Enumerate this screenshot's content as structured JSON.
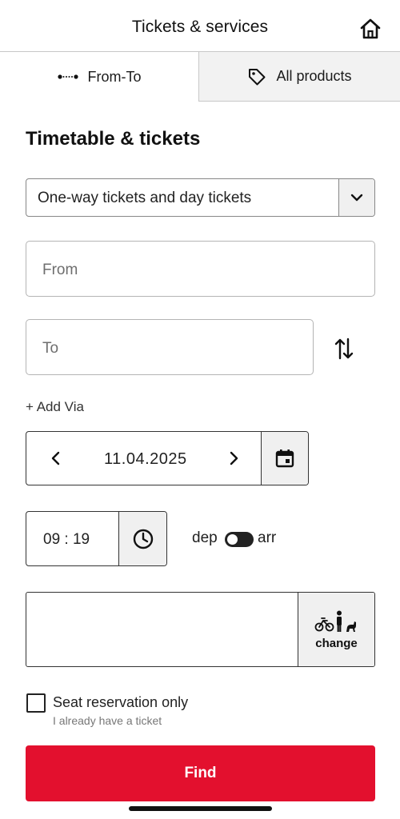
{
  "header": {
    "title": "Tickets & services",
    "home_icon": "home-icon"
  },
  "tabs": [
    {
      "label": "From-To",
      "icon": "route-dots-icon",
      "active": true
    },
    {
      "label": "All products",
      "icon": "tag-icon",
      "active": false
    }
  ],
  "form": {
    "section_title": "Timetable & tickets",
    "ticket_type": {
      "selected": "One-way tickets and day tickets"
    },
    "from": {
      "placeholder": "From",
      "value": ""
    },
    "to": {
      "placeholder": "To",
      "value": ""
    },
    "add_via": "+ Add Via",
    "date": {
      "value": "11.04.2025"
    },
    "time": {
      "value": "09 : 19"
    },
    "dep_arr": {
      "dep_label": "dep",
      "arr_label": "arr",
      "selected": "dep"
    },
    "travellers": {
      "change_label": "change"
    },
    "seat_reservation": {
      "label": "Seat reservation only",
      "hint": "I already have a ticket",
      "checked": false
    },
    "find_label": "Find"
  },
  "colors": {
    "primary": "#e3102e",
    "text": "#1a1a1a",
    "secondary_bg": "#f0f0f0",
    "border": "#878787"
  }
}
